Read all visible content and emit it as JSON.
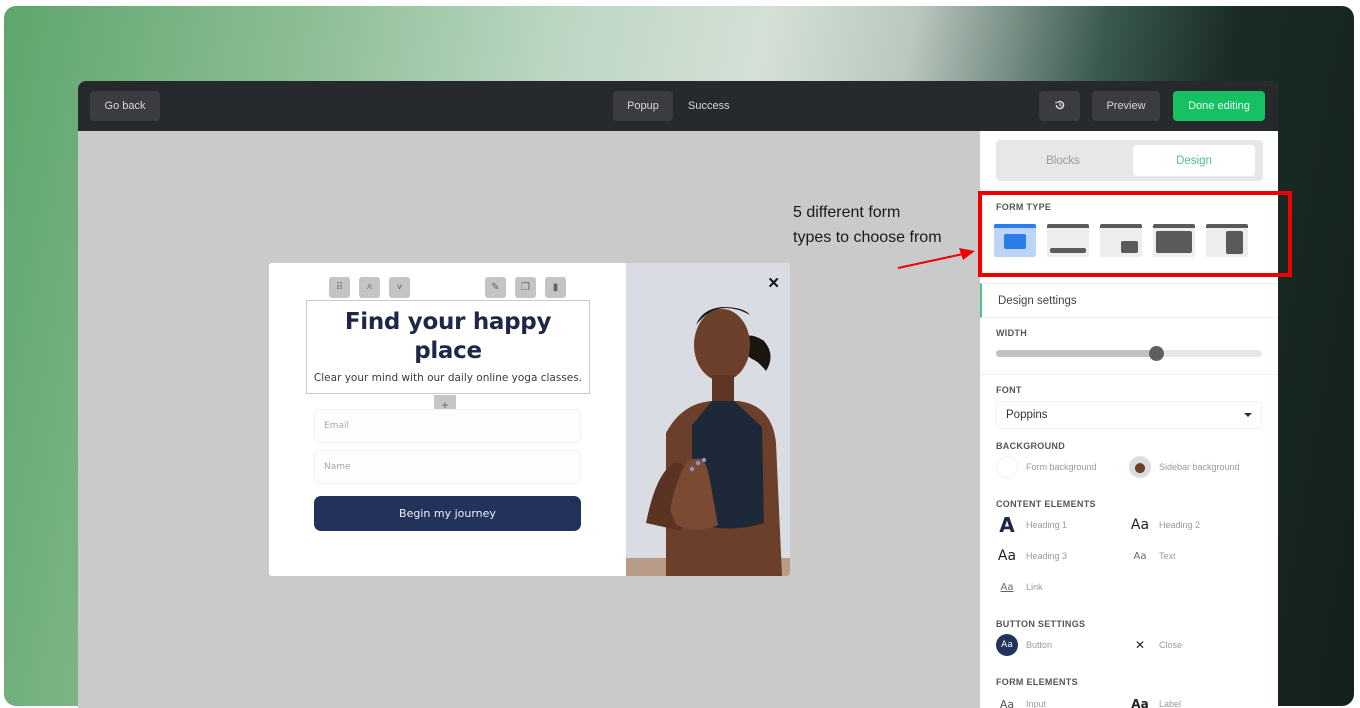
{
  "topbar": {
    "go_back": "Go back",
    "tabs": [
      {
        "label": "Popup",
        "active": true
      },
      {
        "label": "Success",
        "active": false
      }
    ],
    "history_icon": "history-icon",
    "preview": "Preview",
    "done": "Done editing"
  },
  "popup": {
    "block_tools": {
      "left": [
        "drag-handle-icon",
        "chevron-up-icon",
        "chevron-down-icon"
      ],
      "right": [
        "pencil-icon",
        "copy-icon",
        "trash-icon"
      ]
    },
    "heading_line1": "Find your happy",
    "heading_line2": "place",
    "subheading": "Clear your mind with our daily online yoga classes.",
    "add_block": "+",
    "email_placeholder": "Email",
    "name_placeholder": "Name",
    "cta": "Begin my journey",
    "close": "✕"
  },
  "annotation": {
    "line1": "5 different form",
    "line2": "types to choose from"
  },
  "panel": {
    "tabs": [
      {
        "label": "Blocks",
        "active": false
      },
      {
        "label": "Design",
        "active": true
      }
    ],
    "form_type": {
      "label": "FORM TYPE",
      "options": [
        "popup",
        "bar",
        "corner-slide-in",
        "full-screen",
        "sidebar"
      ],
      "selected": "popup"
    },
    "design_settings": "Design settings",
    "width": {
      "label": "WIDTH",
      "value_fraction": 0.6
    },
    "font": {
      "label": "FONT",
      "value": "Poppins"
    },
    "background": {
      "label": "BACKGROUND",
      "items": [
        {
          "label": "Form background"
        },
        {
          "label": "Sidebar background"
        }
      ]
    },
    "content_elements": {
      "label": "CONTENT ELEMENTS",
      "items": [
        {
          "glyph": "A",
          "label": "Heading 1"
        },
        {
          "glyph": "Aa",
          "label": "Heading 2"
        },
        {
          "glyph": "Aa",
          "label": "Heading 3"
        },
        {
          "glyph": "Aa",
          "label": "Text"
        },
        {
          "glyph": "Aa",
          "label": "Link"
        }
      ]
    },
    "button_settings": {
      "label": "BUTTON SETTINGS",
      "items": [
        {
          "glyph": "Aa",
          "label": "Button"
        },
        {
          "glyph": "✕",
          "label": "Close"
        }
      ]
    },
    "form_elements": {
      "label": "FORM ELEMENTS",
      "items": [
        {
          "glyph": "Aa",
          "label": "Input"
        },
        {
          "glyph": "Aa",
          "label": "Label"
        }
      ]
    }
  },
  "colors": {
    "accent_green": "#16c163",
    "cta_navy": "#22325a",
    "highlight_red": "#ee0000",
    "selected_blue": "#2b7de8"
  }
}
